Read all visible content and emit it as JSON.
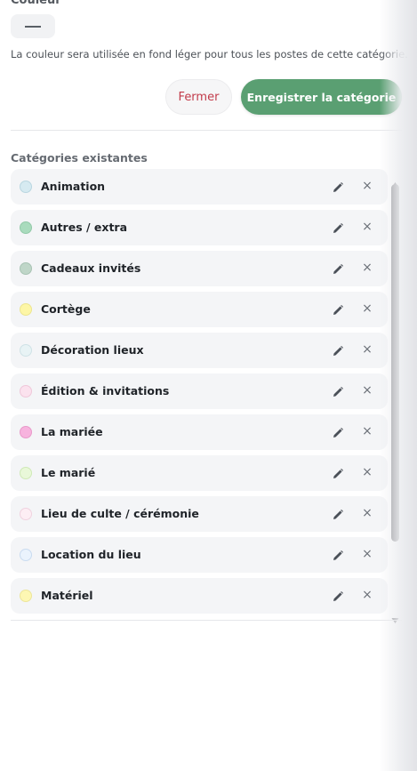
{
  "form": {
    "color_label": "Couleur",
    "help_text": "La couleur sera utilisée en fond léger pour tous les postes de cette catégorie.",
    "close_label": "Fermer",
    "save_label": "Enregistrer la catégorie"
  },
  "categories": {
    "title": "Catégories existantes",
    "edit_icon": "pencil-icon",
    "delete_icon": "close-icon",
    "delete_glyph": "×",
    "items": [
      {
        "label": "Animation",
        "color": "#d6eaf1",
        "border": "#b9d6e0"
      },
      {
        "label": "Autres / extra",
        "color": "#a9dbbd",
        "border": "#92c9a8"
      },
      {
        "label": "Cadeaux invités",
        "color": "#bfd6c8",
        "border": "#a8c3b3"
      },
      {
        "label": "Cortège",
        "color": "#fdf6a6",
        "border": "#ece58f"
      },
      {
        "label": "Décoration lieux",
        "color": "#e8f3f5",
        "border": "#cfe2e6"
      },
      {
        "label": "Édition & invitations",
        "color": "#fbe2ee",
        "border": "#efc7d9"
      },
      {
        "label": "La mariée",
        "color": "#f7b3de",
        "border": "#e899c9"
      },
      {
        "label": "Le marié",
        "color": "#e9f8d9",
        "border": "#cfe9b6"
      },
      {
        "label": "Lieu de culte / cérémonie",
        "color": "#fdeef4",
        "border": "#f0d2df"
      },
      {
        "label": "Location du lieu",
        "color": "#eaf3fd",
        "border": "#c9dbf0"
      },
      {
        "label": "Matériel",
        "color": "#fdf7b3",
        "border": "#ece59a"
      }
    ]
  }
}
